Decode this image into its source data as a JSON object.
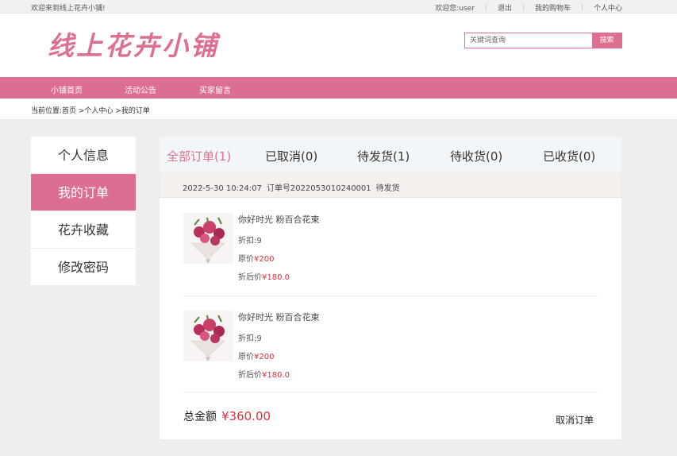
{
  "topbar": {
    "welcome": "欢迎来到线上花卉小铺!",
    "user_greeting": "欢迎您:user",
    "logout": "退出",
    "cart": "我的购物车",
    "profile": "个人中心"
  },
  "header": {
    "logo": "线上花卉小铺",
    "search_placeholder": "关键词查询",
    "search_button": "搜索"
  },
  "nav": {
    "items": [
      "小铺首页",
      "活动公告",
      "买家留言"
    ]
  },
  "breadcrumb": "当前位置:首页 >个人中心 >我的订单",
  "sidebar": {
    "items": [
      "个人信息",
      "我的订单",
      "花卉收藏",
      "修改密码"
    ],
    "active": "我的订单"
  },
  "tabs": [
    {
      "label": "全部订单(1)"
    },
    {
      "label": "已取消(0)"
    },
    {
      "label": "待发货(1)"
    },
    {
      "label": "待收货(0)"
    },
    {
      "label": "已收货(0)"
    }
  ],
  "order": {
    "date": "2022-5-30 10:24:07",
    "order_no": "订单号2022053010240001",
    "status": "待发货",
    "items": [
      {
        "name": "你好时光 粉百合花束",
        "discount": "折扣:9",
        "orig_label": "原价",
        "orig_price": "¥200",
        "final_label": "折后价",
        "final_price": "¥180.0"
      },
      {
        "name": "你好时光 粉百合花束",
        "discount": "折扣:9",
        "orig_label": "原价",
        "orig_price": "¥200",
        "final_label": "折后价",
        "final_price": "¥180.0"
      }
    ],
    "total_label": "总金额",
    "total_amount": "¥360.00",
    "cancel": "取消订单"
  },
  "colors": {
    "accent": "#dc6e92",
    "price": "#e0303a"
  }
}
